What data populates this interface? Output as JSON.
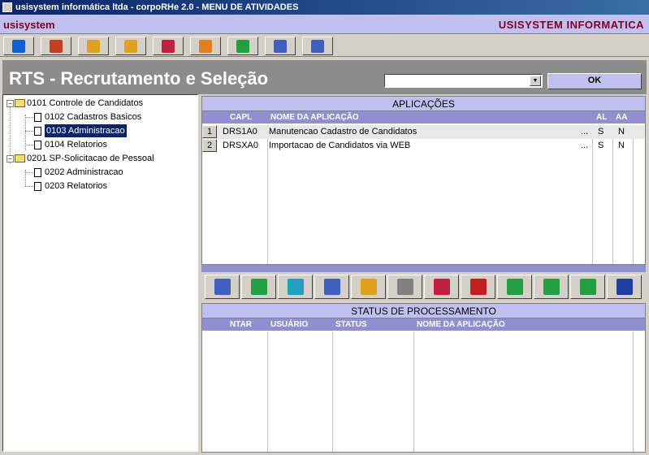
{
  "window": {
    "title": "usisystem informática ltda - corpoRHe 2.0 - MENU DE ATIVIDADES"
  },
  "brand": {
    "left": "usisystem",
    "right": "USISYSTEM INFORMATICA"
  },
  "top_toolbar": [
    {
      "icon": "back-arrow-icon",
      "color": "#1060d0"
    },
    {
      "icon": "users-icon",
      "color": "#c04020"
    },
    {
      "icon": "hand-icon",
      "color": "#e0a020"
    },
    {
      "icon": "exit-icon",
      "color": "#e0a020"
    },
    {
      "icon": "checklist-icon",
      "color": "#c02040"
    },
    {
      "icon": "book-orange-icon",
      "color": "#e08020"
    },
    {
      "icon": "book-green-icon",
      "color": "#20a040"
    },
    {
      "icon": "window-settings-icon",
      "color": "#4060c0"
    },
    {
      "icon": "window-config-icon",
      "color": "#4060c0"
    }
  ],
  "header": {
    "title": "RTS - Recrutamento e Seleção",
    "combo_value": "",
    "ok_label": "OK"
  },
  "tree": {
    "items": [
      {
        "label": "0101 Controle de Candidatos",
        "type": "folder"
      },
      {
        "label": "0102 Cadastros Basicos",
        "type": "doc"
      },
      {
        "label": "0103 Administracao",
        "type": "doc",
        "selected": true
      },
      {
        "label": "0104 Relatorios",
        "type": "doc"
      },
      {
        "label": "0201 SP-Solicitacao de Pessoal",
        "type": "folder"
      },
      {
        "label": "0202 Administracao",
        "type": "doc"
      },
      {
        "label": "0203 Relatorios",
        "type": "doc"
      }
    ]
  },
  "applications": {
    "title": "APLICAÇÕES",
    "headers": {
      "capl": "CAPL",
      "nome": "NOME DA APLICAÇÃO",
      "al": "AL",
      "aa": "AA"
    },
    "rows": [
      {
        "num": "1",
        "capl": "DRS1A0",
        "nome": "Manutencao Cadastro de Candidatos",
        "dots": "...",
        "al": "S",
        "aa": "N"
      },
      {
        "num": "2",
        "capl": "DRSXA0",
        "nome": "Importacao de Candidatos via WEB",
        "dots": "...",
        "al": "S",
        "aa": "N"
      }
    ]
  },
  "bottom_toolbar": [
    {
      "icon": "tree-view-icon",
      "color": "#4060c0"
    },
    {
      "icon": "tree-add-icon",
      "color": "#20a040"
    },
    {
      "icon": "refresh-icon",
      "color": "#20a0c0"
    },
    {
      "icon": "window-settings-icon",
      "color": "#4060c0"
    },
    {
      "icon": "clock-icon",
      "color": "#e0a020"
    },
    {
      "icon": "printer-icon",
      "color": "#808080"
    },
    {
      "icon": "upload-doc-icon",
      "color": "#c02040"
    },
    {
      "icon": "undo-icon",
      "color": "#c02020"
    },
    {
      "icon": "next-page-icon",
      "color": "#20a040"
    },
    {
      "icon": "prev-page-icon",
      "color": "#20a040"
    },
    {
      "icon": "redo-icon",
      "color": "#20a040"
    },
    {
      "icon": "word-doc-icon",
      "color": "#2040a0"
    }
  ],
  "status": {
    "title": "STATUS DE PROCESSAMENTO",
    "headers": {
      "ntar": "NTAR",
      "usuario": "USUÁRIO",
      "status": "STATUS",
      "nome": "NOME DA APLICAÇÃO"
    }
  }
}
